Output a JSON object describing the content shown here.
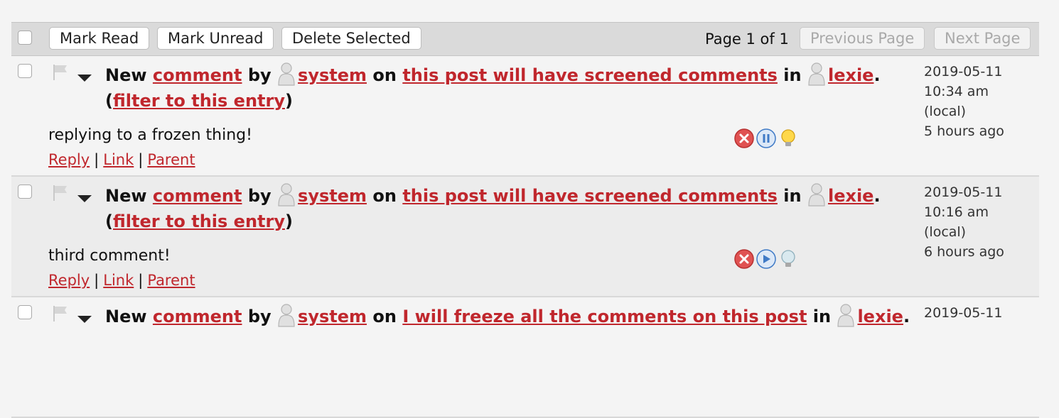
{
  "toolbar": {
    "mark_read": "Mark Read",
    "mark_unread": "Mark Unread",
    "delete_selected": "Delete Selected",
    "page_info": "Page 1 of 1",
    "previous_page": "Previous Page",
    "next_page": "Next Page"
  },
  "colors": {
    "link": "#c0272d",
    "toolbar_bg": "#dadada",
    "alt_row_bg": "#ececec"
  },
  "notifications": [
    {
      "new": "New",
      "comment_link": "comment",
      "by": "by",
      "user": "system",
      "on": "on",
      "post": "this post will have screened comments",
      "in": "in",
      "journal": "lexie",
      "period": ".",
      "paren_open": "(",
      "filter": "filter to this entry",
      "paren_close": ")",
      "text": "replying to a frozen thing!",
      "reply": "Reply",
      "link": "Link",
      "parent": "Parent",
      "divider": "|",
      "date": "2019-05-11",
      "time": "10:34 am",
      "tz": "(local)",
      "ago": "5 hours ago",
      "icons": [
        "delete-icon",
        "freeze-icon",
        "screen-icon"
      ]
    },
    {
      "new": "New",
      "comment_link": "comment",
      "by": "by",
      "user": "system",
      "on": "on",
      "post": "this post will have screened comments",
      "in": "in",
      "journal": "lexie",
      "period": ".",
      "paren_open": "(",
      "filter": "filter to this entry",
      "paren_close": ")",
      "text": "third comment!",
      "reply": "Reply",
      "link": "Link",
      "parent": "Parent",
      "divider": "|",
      "date": "2019-05-11",
      "time": "10:16 am",
      "tz": "(local)",
      "ago": "6 hours ago",
      "icons": [
        "delete-icon",
        "unfreeze-icon",
        "unscreen-icon"
      ]
    },
    {
      "new": "New",
      "comment_link": "comment",
      "by": "by",
      "user": "system",
      "on": "on",
      "post": "I will freeze all the comments on this post",
      "in": "in",
      "journal": "lexie",
      "period": ".",
      "date": "2019-05-11"
    }
  ]
}
